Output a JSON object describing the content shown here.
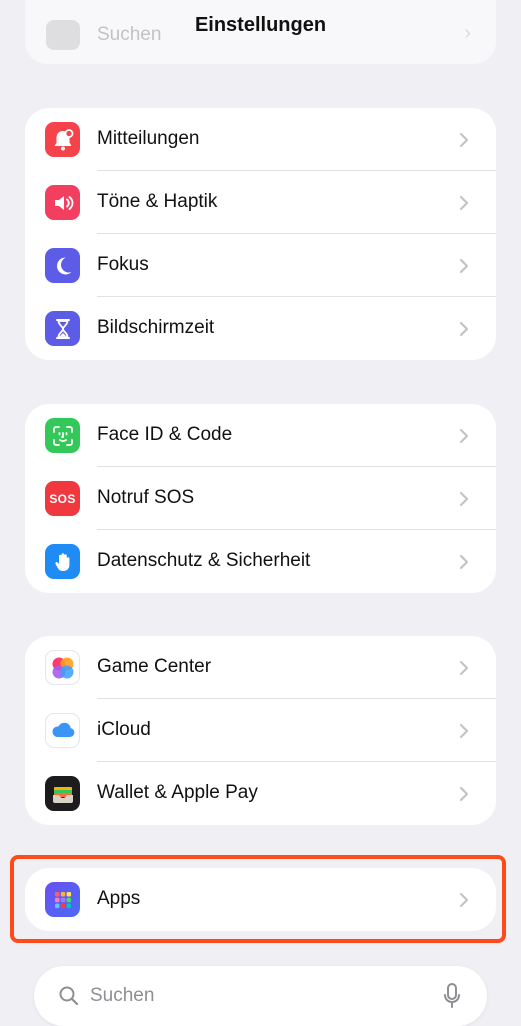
{
  "header": {
    "title": "Einstellungen",
    "ghost_search_label": "Suchen"
  },
  "groups": [
    {
      "items": [
        {
          "label": "Mitteilungen",
          "icon": "notifications-icon",
          "color": "#f4434a"
        },
        {
          "label": "Töne & Haptik",
          "icon": "speaker-icon",
          "color": "#f23f60"
        },
        {
          "label": "Fokus",
          "icon": "moon-icon",
          "color": "#5d5ce6"
        },
        {
          "label": "Bildschirmzeit",
          "icon": "hourglass-icon",
          "color": "#5d5ce6"
        }
      ]
    },
    {
      "items": [
        {
          "label": "Face ID & Code",
          "icon": "face-id-icon",
          "color": "#34c759"
        },
        {
          "label": "Notruf SOS",
          "icon": "sos-icon",
          "color": "#f0383e",
          "icon_text": "SOS"
        },
        {
          "label": "Datenschutz & Sicherheit",
          "icon": "hand-icon",
          "color": "#1f8bf5"
        }
      ]
    },
    {
      "items": [
        {
          "label": "Game Center",
          "icon": "game-center-icon",
          "color": "#ffffff"
        },
        {
          "label": "iCloud",
          "icon": "icloud-icon",
          "color": "#ffffff"
        },
        {
          "label": "Wallet & Apple Pay",
          "icon": "wallet-icon",
          "color": "#1c1c1e"
        }
      ]
    },
    {
      "items": [
        {
          "label": "Apps",
          "icon": "apps-icon",
          "color": "#5b4fe0"
        }
      ]
    }
  ],
  "bottom_search": {
    "placeholder": "Suchen"
  },
  "colors": {
    "highlight": "#ff4a1c",
    "background": "#efeff4"
  }
}
